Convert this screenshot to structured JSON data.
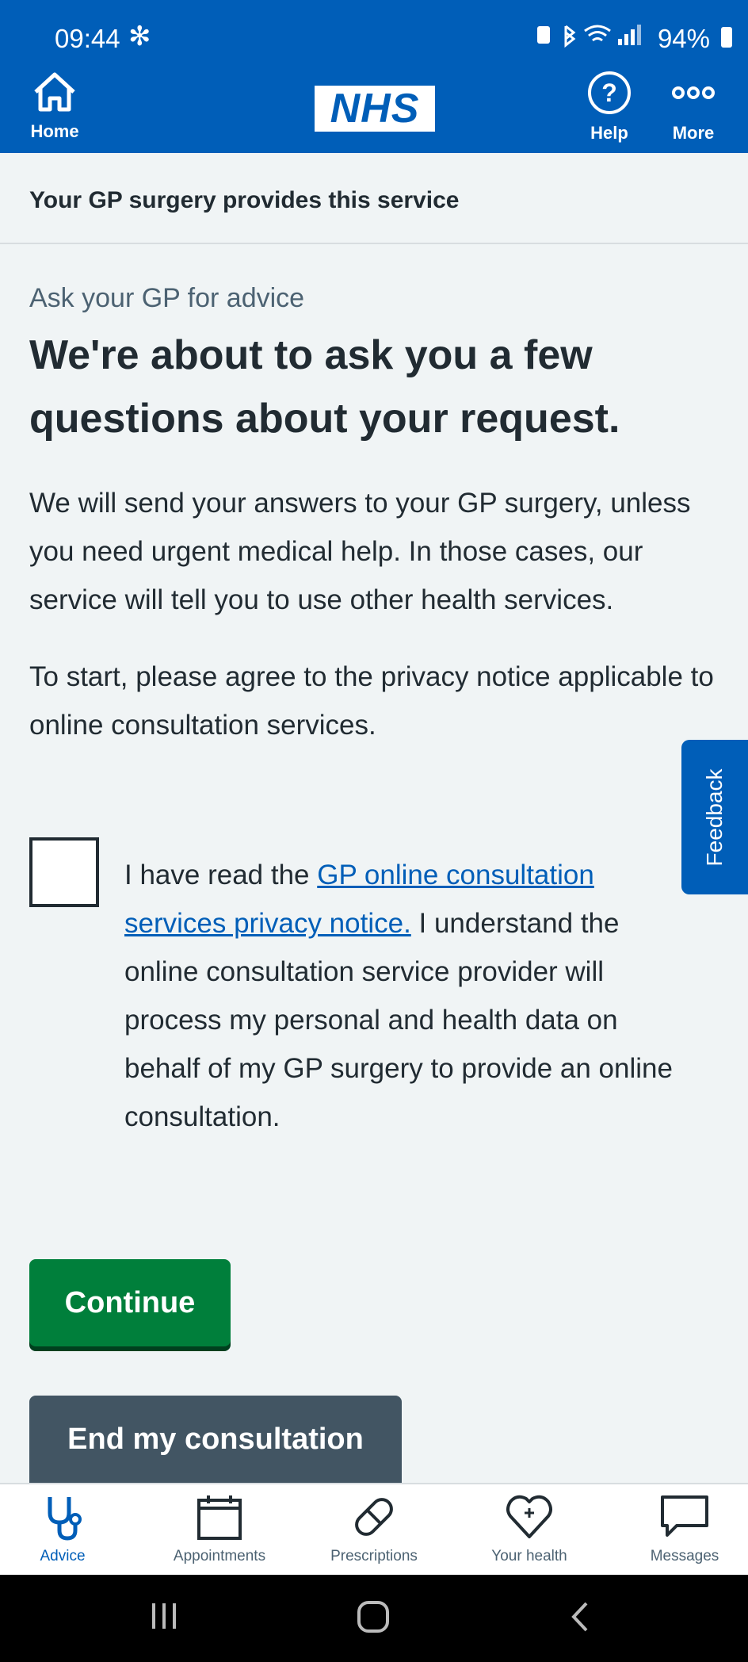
{
  "status_bar": {
    "time": "09:44",
    "battery": "94%"
  },
  "header": {
    "home_label": "Home",
    "logo_text": "NHS",
    "help_label": "Help",
    "more_label": "More"
  },
  "service_bar": {
    "text": "Your GP surgery provides this service"
  },
  "page": {
    "caption": "Ask your GP for advice",
    "title": "We're about to ask you a few questions about your request.",
    "para1": "We will send your answers to your GP surgery, unless you need urgent medical help. In those cases, our service will tell you to use other health services.",
    "para2": "To start, please agree to the privacy notice applicable to online consultation services."
  },
  "consent": {
    "prefix": "I have read the ",
    "link_text": "GP online consultation services privacy notice.",
    "suffix": " I understand the online consultation service provider will process my personal and health data on behalf of my GP surgery to provide an online consultation.",
    "checked": false
  },
  "feedback_label": "Feedback",
  "buttons": {
    "continue": "Continue",
    "end": "End my consultation"
  },
  "tabs": [
    {
      "label": "Advice",
      "icon": "stethoscope-icon",
      "active": true
    },
    {
      "label": "Appointments",
      "icon": "calendar-icon",
      "active": false
    },
    {
      "label": "Prescriptions",
      "icon": "pill-icon",
      "active": false
    },
    {
      "label": "Your health",
      "icon": "heart-icon",
      "active": false
    },
    {
      "label": "Messages",
      "icon": "message-icon",
      "active": false
    }
  ],
  "colors": {
    "nhs_blue": "#005eb8",
    "continue_green": "#007f3b",
    "end_grey": "#425563",
    "background": "#f0f4f5"
  }
}
